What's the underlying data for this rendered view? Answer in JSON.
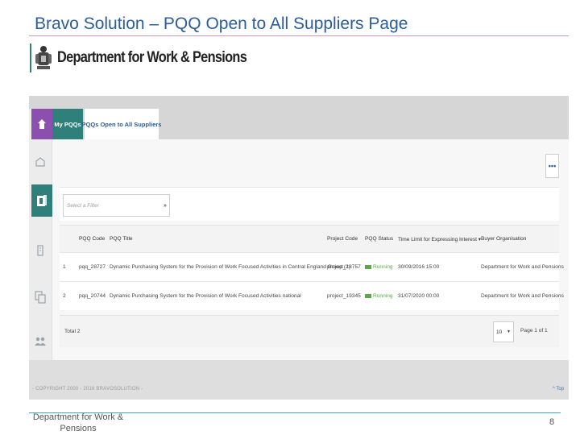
{
  "slide": {
    "title": "Bravo Solution – PQQ Open to All Suppliers Page",
    "logo_text": "Department for Work & Pensions",
    "footer_org": "Department for Work & Pensions",
    "page_number": "8"
  },
  "colors": {
    "title": "#2a5d9c",
    "title_rule": "#c79ac4",
    "teal": "#2f7f7a",
    "purple": "#8c4fb0",
    "running": "#5aa84a",
    "footer_rule": "#3fa7b5"
  },
  "app": {
    "tabs": [
      {
        "label": "My PQQs"
      },
      {
        "label": "PQQs Open to All Suppliers"
      }
    ],
    "sidebar_icons": [
      "home-icon",
      "dashboard-icon",
      "pqq-icon",
      "building-icon",
      "documents-icon",
      "users-icon"
    ],
    "more_button": "•••",
    "filter": {
      "placeholder": "Select a Filter"
    },
    "table": {
      "headers": [
        "PQQ Code",
        "PQQ Title",
        "Project Code",
        "PQQ Status",
        "Time Limit for Expressing Interest ▾",
        "Buyer Organisation"
      ],
      "rows": [
        {
          "index": "1",
          "code": "pqq_28727",
          "title": "Dynamic Purchasing System for the Provision of Work Focused Activities in Central England Group (2)",
          "project": "project_18757",
          "status": "Running",
          "time_limit": "30/09/2016 15:00",
          "buyer": "Department for Work and Pensions"
        },
        {
          "index": "2",
          "code": "pqq_20744",
          "title": "Dynamic Purchasing System for the Provision of Work Focused Activities national",
          "project": "project_19345",
          "status": "Running",
          "time_limit": "31/07/2020 00:00",
          "buyer": "Department for Work and Pensions"
        }
      ],
      "total": "Total 2",
      "page_size": "10",
      "page_info": "Page 1 of 1"
    },
    "copyright": "- COPYRIGHT 2000 - 2016 BRAVOSOLUTION -",
    "top_link": "^ Top"
  }
}
